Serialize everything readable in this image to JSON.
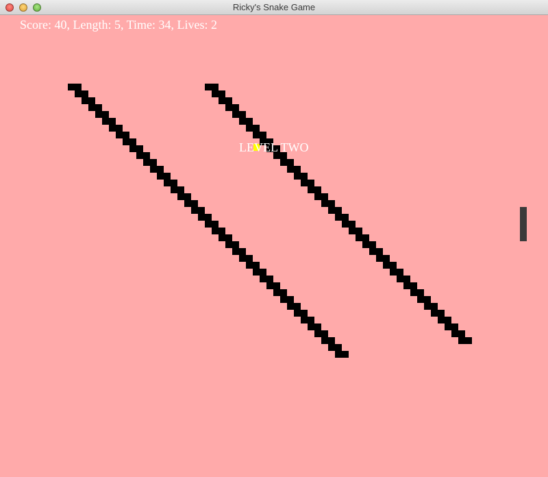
{
  "window": {
    "title": "Ricky's Snake Game"
  },
  "colors": {
    "background": "#ffaaaa",
    "wall": "#000000",
    "text": "#ffffff",
    "food": "#ffff00",
    "paddle": "#3a3a3a"
  },
  "hud": {
    "status_text": "Score: 40, Length: 5, Time: 34, Lives: 2"
  },
  "level": {
    "label": "LEVEL TWO"
  }
}
